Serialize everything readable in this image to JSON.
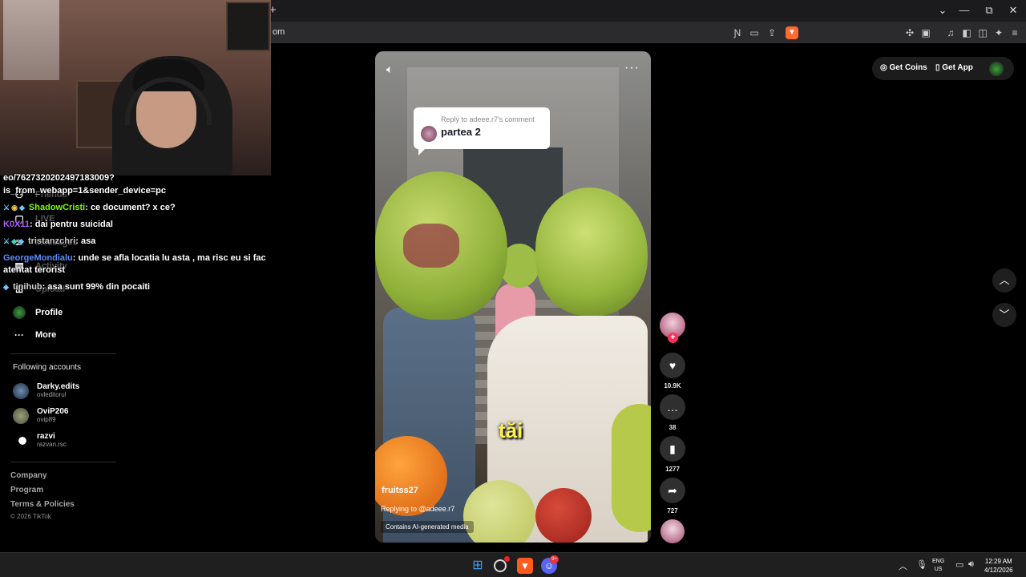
{
  "browser": {
    "new_tab_label": "+",
    "url_fragment": "om",
    "window_controls": {
      "dropdown": "⌄",
      "minimize": "—",
      "restore": "⧉",
      "close": "✕"
    }
  },
  "sidebar": {
    "items": [
      {
        "label": "Friends",
        "icon": "friends-icon"
      },
      {
        "label": "LIVE",
        "icon": "live-icon"
      },
      {
        "label": "Messages",
        "icon": "messages-icon"
      },
      {
        "label": "Activity",
        "icon": "activity-icon"
      },
      {
        "label": "Upload",
        "icon": "upload-icon"
      },
      {
        "label": "Profile",
        "icon": "profile-icon"
      },
      {
        "label": "More",
        "icon": "more-icon"
      }
    ],
    "following_title": "Following accounts",
    "following": [
      {
        "name": "Darky.edits",
        "handle": "ovleditorul"
      },
      {
        "name": "OviP206",
        "handle": "ovip89"
      },
      {
        "name": "razvi",
        "handle": "razvan.rsc"
      }
    ],
    "footer": {
      "links": [
        "Company",
        "Program",
        "Terms & Policies"
      ],
      "copyright": "© 2026 TikTok"
    }
  },
  "chat": {
    "lines": [
      {
        "text": "eo/7627320202497183009?"
      },
      {
        "text": "is_from_webapp=1&sender_device=pc"
      },
      {
        "user": "ShadowCristi",
        "color": "#7CFC00",
        "message": ": ce document? x ce?"
      },
      {
        "user": "K0X11",
        "color": "#b05cff",
        "message": ": dai pentru suicidal"
      },
      {
        "user": "tristanzchri",
        "color": "#c9c9c9",
        "message": ": asa"
      },
      {
        "user": "GeorgeMondialu",
        "color": "#5a8cff",
        "message": ": unde se afla locatia lu asta , ma risc eu si fac"
      },
      {
        "text": "atentat terorist"
      },
      {
        "user": "tinihub",
        "color": "#d0d0d0",
        "message": ": asa sunt 99% din pocaiti"
      }
    ]
  },
  "video": {
    "reply_header": "Reply to adeee.r7's comment",
    "reply_text": "partea 2",
    "caption": "tăi",
    "author": "fruitss27",
    "replying_to": "Replying to @adeee.r7",
    "ai_label": "Contains AI-generated media"
  },
  "actions": {
    "likes": "10.9K",
    "comments": "38",
    "saves": "1277",
    "shares": "727"
  },
  "topbar": {
    "get_coins": "Get Coins",
    "get_app": "Get App"
  },
  "taskbar": {
    "lang_line1": "ENG",
    "lang_line2": "US",
    "time": "12:29 AM",
    "date": "4/12/2026",
    "discord_badge": "9+"
  },
  "colors": {
    "tiktok_red": "#fe2c55",
    "reply_yellow": "#fff44f"
  }
}
